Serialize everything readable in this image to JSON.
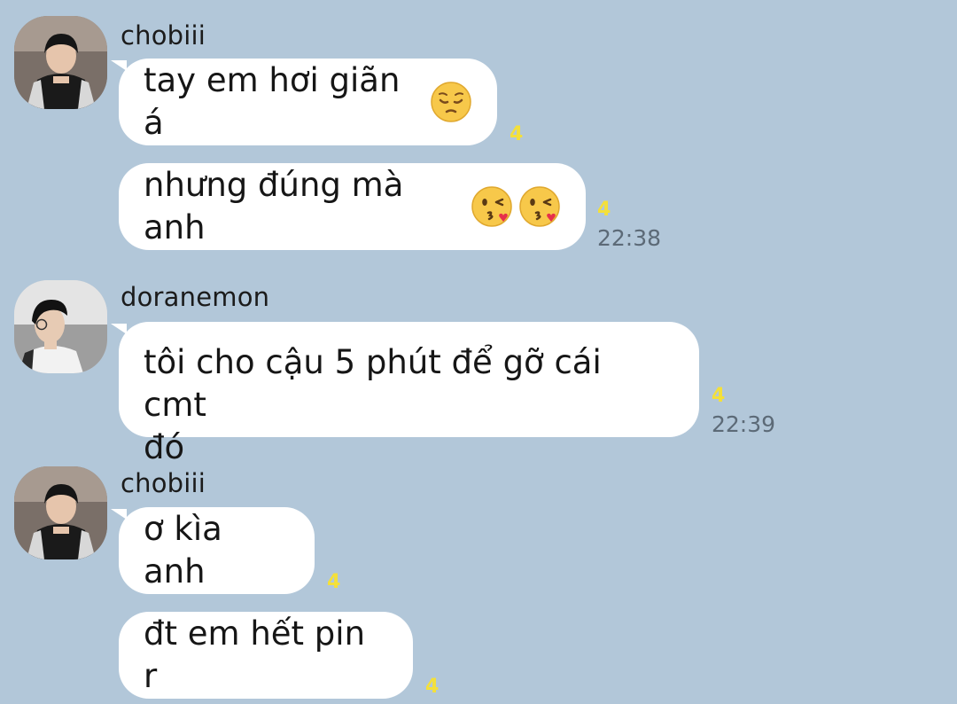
{
  "messages": [
    {
      "sender": "chobiii",
      "text": "tay em hơi giãn á",
      "unread": "4"
    },
    {
      "text": "nhưng đúng mà anh",
      "unread": "4",
      "time": "22:38"
    },
    {
      "sender": "doranemon",
      "text": "tôi cho cậu 5 phút để gỡ cái cmt\nđó",
      "unread": "4",
      "time": "22:39"
    },
    {
      "sender": "chobiii",
      "text": "ơ kìa anh",
      "unread": "4"
    },
    {
      "text": "đt em hết pin r",
      "unread": "4"
    }
  ],
  "icons": {
    "pensive": "pensive-face-emoji",
    "kiss": "face-blowing-kiss-emoji"
  },
  "colors": {
    "background": "#b2c7d9",
    "bubble": "#ffffff",
    "unread": "#f4e03a",
    "time": "#5c6a77"
  }
}
